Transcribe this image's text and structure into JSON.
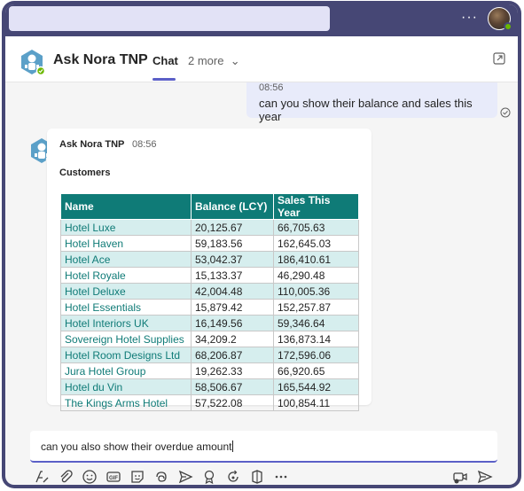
{
  "header": {
    "bot_name": "Ask Nora TNP",
    "tab_active": "Chat",
    "tab_more": "2 more"
  },
  "topbar": {
    "more_label": "···"
  },
  "user_message": {
    "time": "08:56",
    "text": "can you show their balance and sales this year"
  },
  "bot_message": {
    "name": "Ask Nora TNP",
    "time": "08:56",
    "heading": "Customers",
    "table": {
      "columns": [
        "Name",
        "Balance (LCY)",
        "Sales This Year"
      ],
      "rows": [
        [
          "Hotel Luxe",
          "20,125.67",
          "66,705.63"
        ],
        [
          "Hotel Haven",
          "59,183.56",
          "162,645.03"
        ],
        [
          "Hotel Ace",
          "53,042.37",
          "186,410.61"
        ],
        [
          "Hotel Royale",
          "15,133.37",
          "46,290.48"
        ],
        [
          "Hotel Deluxe",
          "42,004.48",
          "110,005.36"
        ],
        [
          "Hotel Essentials",
          "15,879.42",
          "152,257.87"
        ],
        [
          "Hotel Interiors UK",
          "16,149.56",
          "59,346.64"
        ],
        [
          "Sovereign Hotel Supplies",
          "34,209.2",
          "136,873.14"
        ],
        [
          "Hotel Room Designs Ltd",
          "68,206.87",
          "172,596.06"
        ],
        [
          "Jura Hotel Group",
          "19,262.33",
          "66,920.65"
        ],
        [
          "Hotel du Vin",
          "58,506.67",
          "165,544.92"
        ],
        [
          "The Kings Arms Hotel",
          "57,522.08",
          "100,854.11"
        ]
      ]
    }
  },
  "compose": {
    "value": "can you also show their overdue amount"
  },
  "toolbar_icons": [
    "format-icon",
    "attach-icon",
    "emoji-icon",
    "gif-icon",
    "sticker-icon",
    "loop-icon",
    "schedule-send-icon",
    "praise-icon",
    "refresh-icon",
    "apps-icon",
    "more-icon",
    "video-icon",
    "send-icon"
  ],
  "colors": {
    "accent": "#5b5fc7",
    "frame": "#464775",
    "table_header": "#0f7b77",
    "table_alt_row": "#d6eeee"
  }
}
